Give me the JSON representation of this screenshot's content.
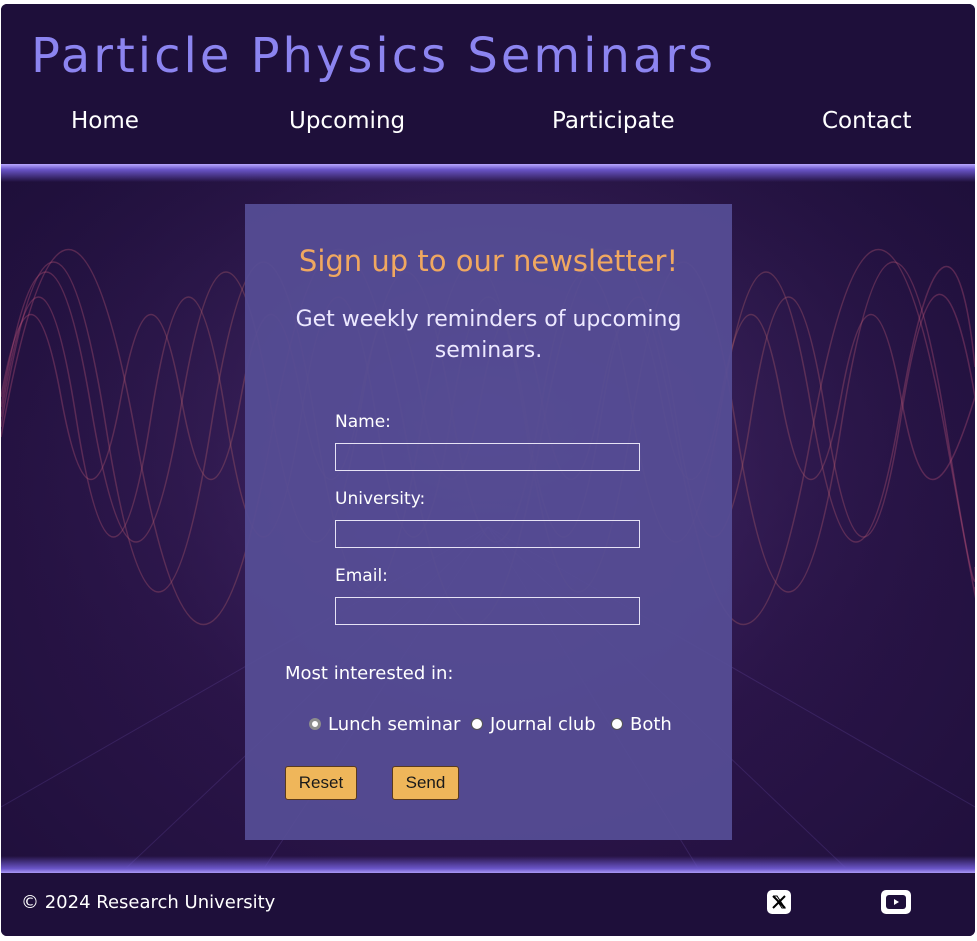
{
  "header": {
    "site_title": "Particle Physics Seminars",
    "nav": [
      {
        "label": "Home"
      },
      {
        "label": "Upcoming"
      },
      {
        "label": "Participate"
      },
      {
        "label": "Contact"
      }
    ]
  },
  "newsletter": {
    "title": "Sign up to our newsletter!",
    "subtitle": "Get weekly reminders of upcoming seminars.",
    "fields": [
      {
        "label": "Name:",
        "value": ""
      },
      {
        "label": "University:",
        "value": ""
      },
      {
        "label": "Email:",
        "value": ""
      }
    ],
    "interest_label": "Most interested in:",
    "options": [
      {
        "label": "Lunch seminar",
        "checked": true
      },
      {
        "label": "Journal club",
        "checked": false
      },
      {
        "label": "Both",
        "checked": false
      }
    ],
    "reset_label": "Reset",
    "send_label": "Send"
  },
  "footer": {
    "copyright": "© 2024 Research University",
    "social": [
      {
        "icon": "x-twitter-icon"
      },
      {
        "icon": "youtube-icon"
      }
    ]
  },
  "colors": {
    "background": "#1e0f3a",
    "title": "#8c84f0",
    "card": "#564e96",
    "accent_heading": "#f0a860",
    "button": "#efb65a"
  }
}
